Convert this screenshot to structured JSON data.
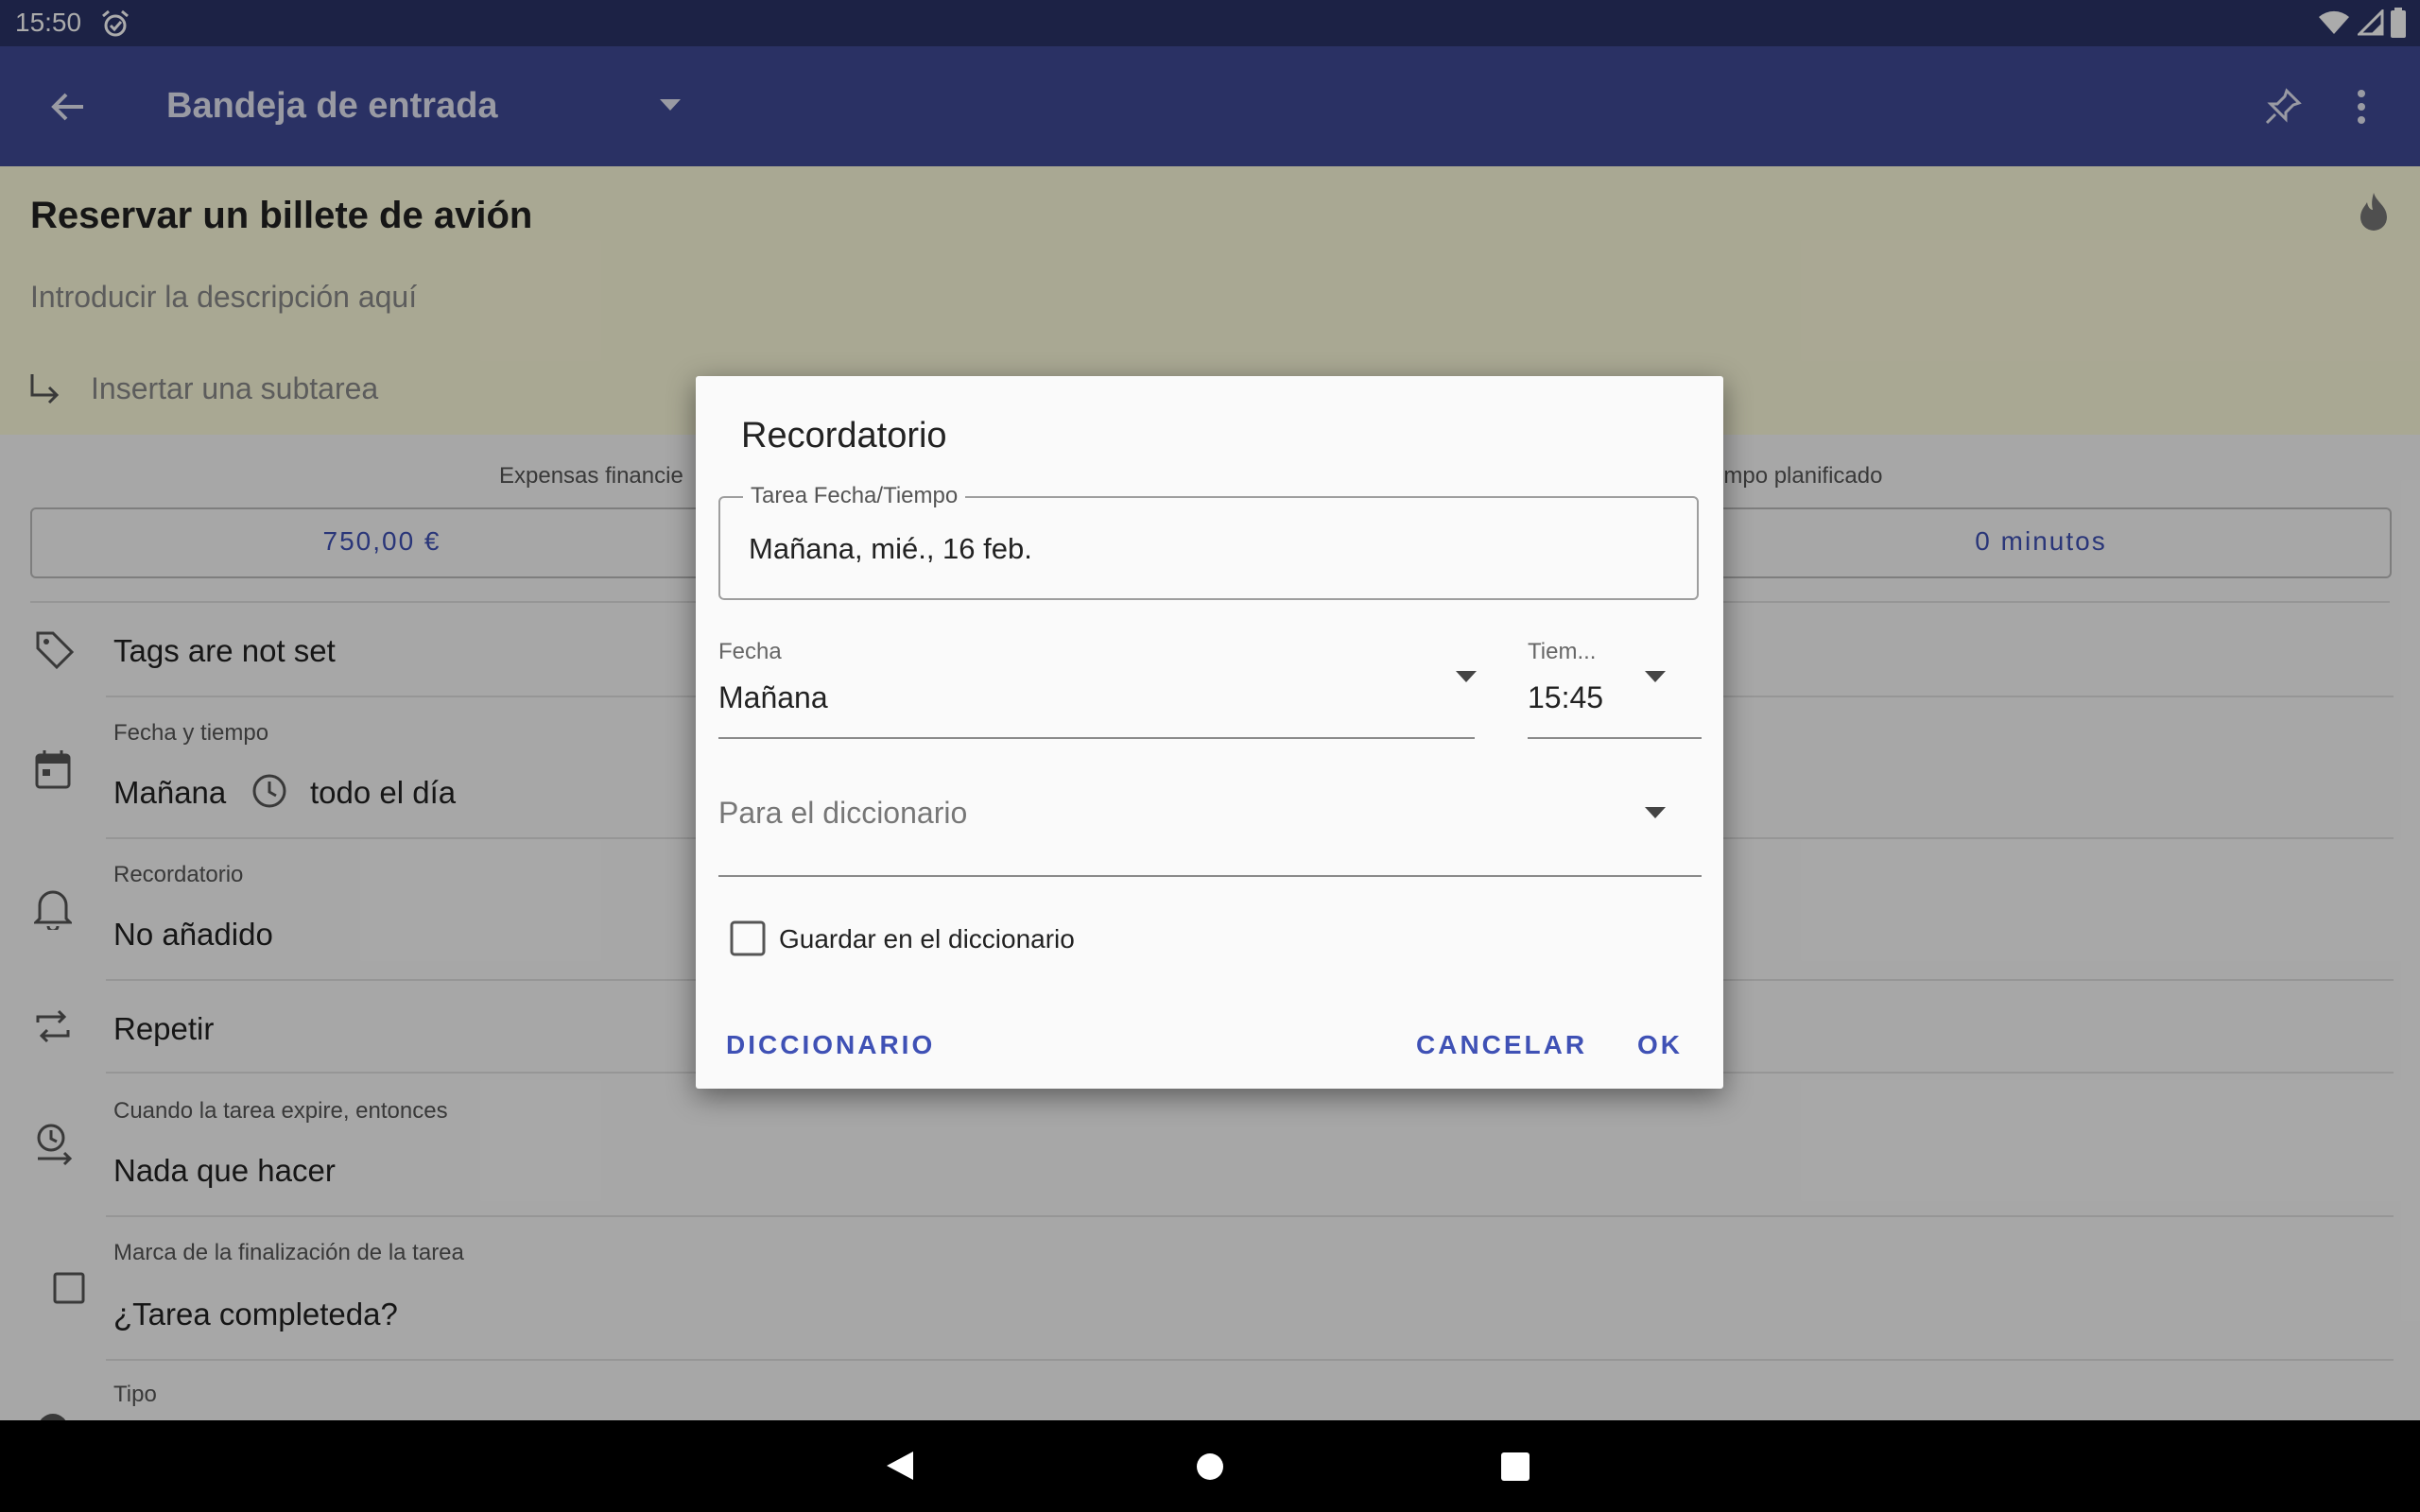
{
  "status_bar": {
    "time": "15:50"
  },
  "app_bar": {
    "title": "Bandeja de entrada"
  },
  "task": {
    "title": "Reservar un billete de avión",
    "description_placeholder": "Introducir la descripción aquí",
    "subtask_placeholder": "Insertar una subtarea"
  },
  "financial": {
    "label": "Expensas financie",
    "value": "750,00 €"
  },
  "planned_time": {
    "label": "empo planificado",
    "value": "0 minutos"
  },
  "rows": {
    "tags": "Tags are not set",
    "date_label": "Fecha y tiempo",
    "date_value": "Mañana",
    "time_value": "todo el día",
    "reminder_label": "Recordatorio",
    "reminder_value": "No añadido",
    "repeat": "Repetir",
    "expire_label": "Cuando la tarea expire, entonces",
    "expire_value": "Nada que hacer",
    "complete_label": "Marca de la finalización de la tarea",
    "complete_value": "¿Tarea completeda?",
    "type_label": "Tipo"
  },
  "dialog": {
    "title": "Recordatorio",
    "datetime_label": "Tarea Fecha/Tiempo",
    "datetime_value": "Mañana, mié., 16 feb.",
    "date_label": "Fecha",
    "date_value": "Mañana",
    "time_label": "Tiem...",
    "time_value": "15:45",
    "dictionary_placeholder": "Para el diccionario",
    "save_checkbox_label": "Guardar en el diccionario",
    "dictionary_button": "DICCIONARIO",
    "cancel_button": "CANCELAR",
    "ok_button": "OK"
  },
  "colors": {
    "status_bar": "#2b3468",
    "app_bar": "#3f4a96",
    "accent": "#3f51b5",
    "header_bg": "#fdfbdc"
  }
}
